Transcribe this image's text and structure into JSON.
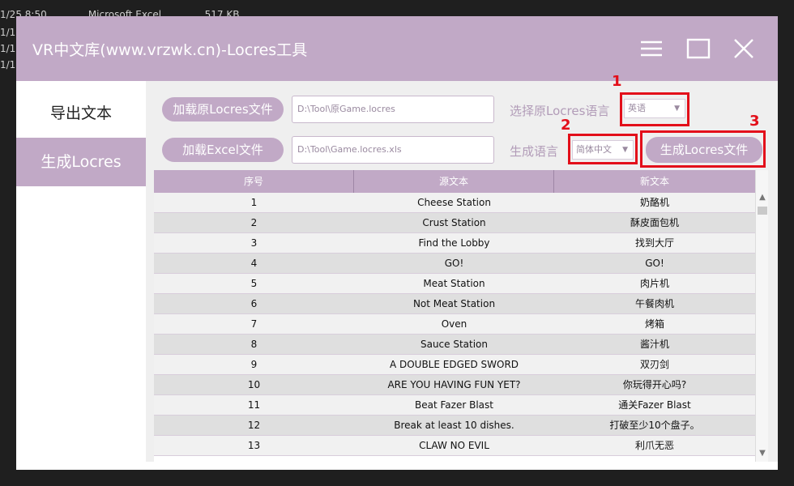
{
  "background_list": {
    "rows": [
      {
        "date": "1/25 8:50",
        "app": "Microsoft Excel",
        "size": "517 KB"
      },
      {
        "date": "1/1",
        "app": "",
        "size": ""
      },
      {
        "date": "1/1",
        "app": "",
        "size": ""
      },
      {
        "date": "1/1",
        "app": "",
        "size": ""
      }
    ]
  },
  "window": {
    "title": "VR中文库(www.vrzwk.cn)-Locres工具",
    "accent_color": "#c1a9c6",
    "controls": [
      "menu-icon",
      "maximize-icon",
      "close-icon"
    ]
  },
  "sidebar": {
    "items": [
      {
        "label": "导出文本",
        "active": false
      },
      {
        "label": "生成Locres",
        "active": true
      }
    ]
  },
  "toolbar": {
    "load_locres_button": "加载原Locres文件",
    "locres_path": "D:\\Tool\\原Game.locres",
    "source_lang_label": "选择原Locres语言",
    "source_lang_value": "英语",
    "load_excel_button": "加载Excel文件",
    "excel_path": "D:\\Tool\\Game.locres.xls",
    "target_lang_label": "生成语言",
    "target_lang_value": "简体中文",
    "generate_button": "生成Locres文件"
  },
  "annotations": {
    "labels": [
      "1",
      "2",
      "3"
    ],
    "color": "#e30f1a"
  },
  "table": {
    "headers": [
      "序号",
      "源文本",
      "新文本"
    ],
    "rows": [
      [
        "1",
        "Cheese Station",
        "奶酪机"
      ],
      [
        "2",
        "Crust Station",
        "酥皮面包机"
      ],
      [
        "3",
        "Find the Lobby",
        "找到大厅"
      ],
      [
        "4",
        "GO!",
        "GO!"
      ],
      [
        "5",
        "Meat Station",
        "肉片机"
      ],
      [
        "6",
        "Not Meat Station",
        "午餐肉机"
      ],
      [
        "7",
        "Oven",
        "烤箱"
      ],
      [
        "8",
        "Sauce Station",
        "酱汁机"
      ],
      [
        "9",
        "A DOUBLE EDGED SWORD",
        "双刃剑"
      ],
      [
        "10",
        "ARE YOU HAVING FUN YET?",
        "你玩得开心吗?"
      ],
      [
        "11",
        "Beat Fazer Blast",
        "通关Fazer Blast"
      ],
      [
        "12",
        "Break at least 10 dishes.",
        "打破至少10个盘子。"
      ],
      [
        "13",
        "CLAW NO EVIL",
        "利爪无恶"
      ]
    ]
  }
}
